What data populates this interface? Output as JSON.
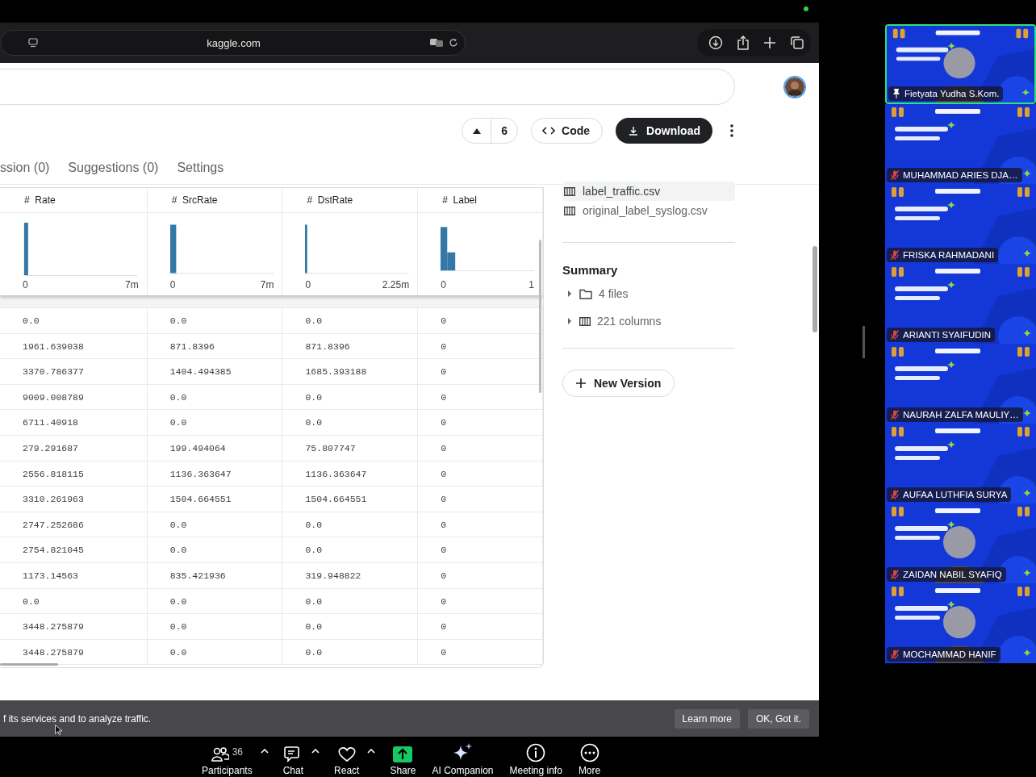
{
  "browser": {
    "url": "kaggle.com"
  },
  "actions": {
    "votes": "6",
    "code": "Code",
    "download": "Download"
  },
  "tabs": [
    {
      "label": "ssion (0)",
      "selected": false
    },
    {
      "label": "Suggestions (0)",
      "selected": false
    },
    {
      "label": "Settings",
      "selected": false
    }
  ],
  "table": {
    "columns": [
      {
        "name": "Rate",
        "type": "#",
        "min": "0",
        "max": "7m"
      },
      {
        "name": "SrcRate",
        "type": "#",
        "min": "0",
        "max": "7m"
      },
      {
        "name": "DstRate",
        "type": "#",
        "min": "0",
        "max": "2.25m"
      },
      {
        "name": "Label",
        "type": "#",
        "min": "0",
        "max": "1"
      }
    ],
    "rows": [
      [
        "0.0",
        "0.0",
        "0.0",
        "0"
      ],
      [
        "1961.639038",
        "871.8396",
        "871.8396",
        "0"
      ],
      [
        "3370.786377",
        "1404.494385",
        "1685.393188",
        "0"
      ],
      [
        "9009.008789",
        "0.0",
        "0.0",
        "0"
      ],
      [
        "6711.40918",
        "0.0",
        "0.0",
        "0"
      ],
      [
        "279.291687",
        "199.494064",
        "75.807747",
        "0"
      ],
      [
        "2556.818115",
        "1136.363647",
        "1136.363647",
        "0"
      ],
      [
        "3310.261963",
        "1504.664551",
        "1504.664551",
        "0"
      ],
      [
        "2747.252686",
        "0.0",
        "0.0",
        "0"
      ],
      [
        "2754.821045",
        "0.0",
        "0.0",
        "0"
      ],
      [
        "1173.14563",
        "835.421936",
        "319.948822",
        "0"
      ],
      [
        "0.0",
        "0.0",
        "0.0",
        "0"
      ],
      [
        "3448.275879",
        "0.0",
        "0.0",
        "0"
      ],
      [
        "3448.275879",
        "0.0",
        "0.0",
        "0"
      ]
    ]
  },
  "files": [
    {
      "name": "label_traffic.csv",
      "selected": true
    },
    {
      "name": "original_label_syslog.csv",
      "selected": false
    }
  ],
  "summary": {
    "title": "Summary",
    "items": [
      {
        "kind": "folder",
        "label": "4 files",
        "expanded": false
      },
      {
        "kind": "columns",
        "label": "221 columns",
        "expanded": false
      }
    ]
  },
  "new_version": "New Version",
  "cookie_banner": {
    "text": "f its services and to analyze traffic.",
    "buttons": [
      "Learn more",
      "OK, Got it."
    ]
  },
  "participants": [
    {
      "name": "Fietyata Yudha S.Kom.",
      "muted": false,
      "speaking": true,
      "camera_on": true
    },
    {
      "name": "MUHAMMAD ARIES DJA…",
      "muted": true,
      "speaking": false,
      "camera_on": false
    },
    {
      "name": "FRISKA RAHMADANI",
      "muted": true,
      "speaking": false,
      "camera_on": false
    },
    {
      "name": "ARIANTI SYAIFUDIN",
      "muted": true,
      "speaking": false,
      "camera_on": false
    },
    {
      "name": "NAURAH ZALFA MAULIY…",
      "muted": true,
      "speaking": false,
      "camera_on": false
    },
    {
      "name": "AUFAA LUTHFIA SURYA",
      "muted": true,
      "speaking": false,
      "camera_on": false
    },
    {
      "name": "ZAIDAN NABIL SYAFIQ",
      "muted": true,
      "speaking": false,
      "camera_on": true
    },
    {
      "name": "MOCHAMMAD HANIF",
      "muted": true,
      "speaking": false,
      "camera_on": true
    }
  ],
  "toolbar": [
    {
      "kind": "participants",
      "label": "Participants",
      "count": "36",
      "has_menu": true
    },
    {
      "kind": "chat",
      "label": "Chat",
      "has_menu": true
    },
    {
      "kind": "react",
      "label": "React",
      "has_menu": true
    },
    {
      "kind": "share",
      "label": "Share",
      "has_menu": false
    },
    {
      "kind": "ai",
      "label": "AI Companion",
      "has_menu": false
    },
    {
      "kind": "info",
      "label": "Meeting info",
      "has_menu": false
    },
    {
      "kind": "more",
      "label": "More",
      "has_menu": false
    }
  ]
}
